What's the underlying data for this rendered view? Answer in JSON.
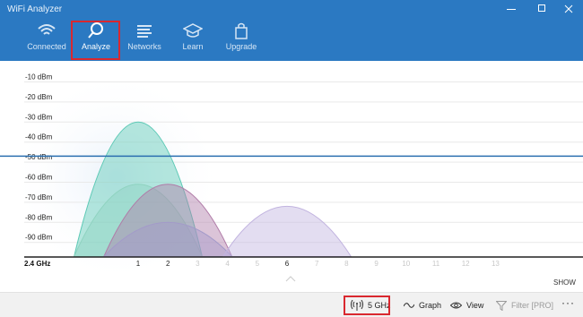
{
  "window": {
    "title": "WiFi Analyzer"
  },
  "nav": [
    {
      "label": "Connected",
      "icon": "wifi-icon"
    },
    {
      "label": "Analyze",
      "icon": "magnifier-icon",
      "active": true
    },
    {
      "label": "Networks",
      "icon": "list-icon"
    },
    {
      "label": "Learn",
      "icon": "graduation-cap-icon"
    },
    {
      "label": "Upgrade",
      "icon": "shopping-bag-icon"
    }
  ],
  "chart": {
    "band_label": "2.4 GHz",
    "show_label": "SHOW",
    "y_ticks": [
      "-10 dBm",
      "-20 dBm",
      "-30 dBm",
      "-40 dBm",
      "-50 dBm",
      "-60 dBm",
      "-70 dBm",
      "-80 dBm",
      "-90 dBm"
    ],
    "x_ticks": [
      "1",
      "2",
      "3",
      "4",
      "5",
      "6",
      "7",
      "8",
      "9",
      "10",
      "11",
      "12",
      "13"
    ]
  },
  "chart_data": {
    "type": "area",
    "xlabel": "",
    "ylabel": "",
    "x_range": [
      -1,
      14
    ],
    "y_range": [
      -100,
      -5
    ],
    "threshold_dbm": -47,
    "series": [
      {
        "center_channel": 1,
        "width_channels": 4,
        "peak_dbm": -30,
        "color": "#5cc9b5"
      },
      {
        "center_channel": 1,
        "width_channels": 4,
        "peak_dbm": -61,
        "color": "#8fd3c0"
      },
      {
        "center_channel": 2,
        "width_channels": 4,
        "peak_dbm": -61,
        "color": "#b07ca8"
      },
      {
        "center_channel": 2,
        "width_channels": 4,
        "peak_dbm": -80,
        "color": "#a39ac9"
      },
      {
        "center_channel": 6,
        "width_channels": 4,
        "peak_dbm": -72,
        "color": "#c1b3df"
      }
    ]
  },
  "bottom": {
    "band": "5 GHz",
    "graph": "Graph",
    "view": "View",
    "filter": "Filter [PRO]",
    "more": "···"
  }
}
